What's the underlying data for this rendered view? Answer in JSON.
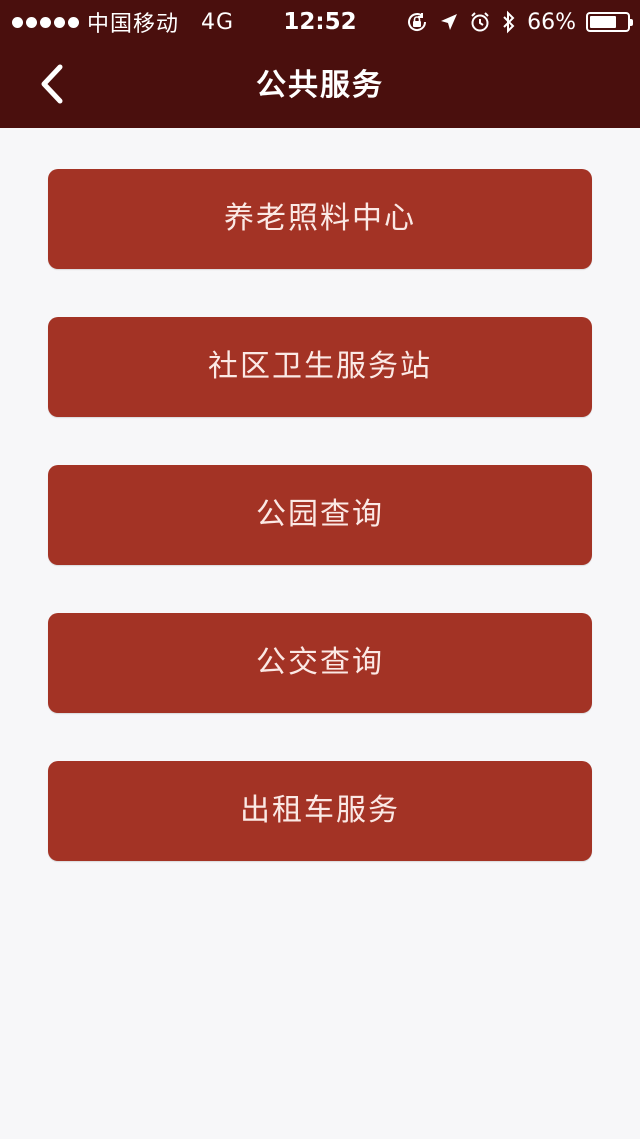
{
  "status_bar": {
    "carrier": "中国移动",
    "network": "4G",
    "time": "12:52",
    "battery_percent": "66%",
    "battery_level": 0.66,
    "icons": [
      "signal-dots-icon",
      "orientation-lock-icon",
      "location-arrow-icon",
      "alarm-icon",
      "bluetooth-icon",
      "battery-icon"
    ]
  },
  "header": {
    "title": "公共服务",
    "back_icon": "chevron-left-icon"
  },
  "colors": {
    "header_bg": "#4a0f0d",
    "button_bg": "#a33325",
    "button_text": "#fbe9e5",
    "page_bg": "#f7f7f9"
  },
  "menu": {
    "items": [
      {
        "label": "养老照料中心"
      },
      {
        "label": "社区卫生服务站"
      },
      {
        "label": "公园查询"
      },
      {
        "label": "公交查询"
      },
      {
        "label": "出租车服务"
      }
    ]
  }
}
